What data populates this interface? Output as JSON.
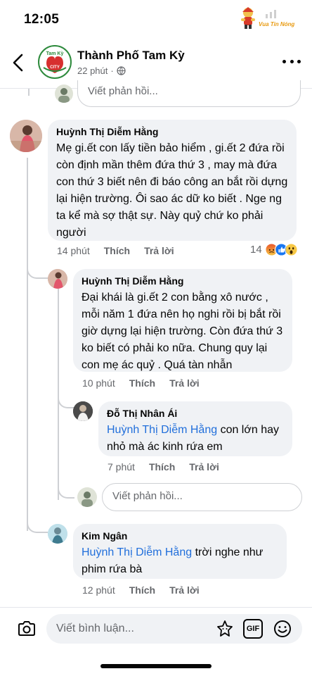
{
  "status_bar": {
    "time": "12:05",
    "watermark_text": "Vua Tin Nóng"
  },
  "header": {
    "page_name": "Thành Phố Tam Kỳ",
    "page_logo_text": "Tam Kỳ",
    "page_logo_sub": "CITY",
    "post_time": "22 phút",
    "audience_icon": "globe-icon"
  },
  "top_reply_placeholder": "Viết phản hồi...",
  "comments": [
    {
      "author": "Huỳnh Thị Diễm Hằng",
      "text": "Mẹ gi.ết con lấy tiền bảo hiểm , gi.ết 2 đứa rồi còn định mần thêm đứa thứ 3 , may mà đứa con thứ 3 biết nên đi báo công an bắt rồi dựng lại hiện trường. Ôi sao ác dữ ko biết . Nge ng ta kể mà sợ thật sự. Này quỷ chứ ko phải người",
      "time": "14 phút",
      "like_label": "Thích",
      "reply_label": "Trả lời",
      "reaction_count": "14",
      "reactions": [
        "angry",
        "like",
        "wow"
      ]
    },
    {
      "author": "Huỳnh Thị Diễm Hằng",
      "text": "Đại khái là gi.ết 2 con bằng xô nước , mỗi năm 1 đứa nên họ nghi rồi bị bắt rồi giờ dựng lại hiện trường. Còn đứa thứ 3 ko biết có phải ko nữa. Chung quy lại con mẹ ác quỷ . Quá tàn nhẫn",
      "time": "10 phút",
      "like_label": "Thích",
      "reply_label": "Trả lời"
    },
    {
      "author": "Đỗ Thị Nhân Ái",
      "mention": "Huỳnh Thị Diễm Hằng",
      "text": "con lớn hay nhỏ mà ác kinh rứa em",
      "time": "7 phút",
      "like_label": "Thích",
      "reply_label": "Trả lời"
    },
    {
      "author": "Kim Ngân",
      "mention": "Huỳnh Thị Diễm Hằng",
      "text": "trời nghe như phim rứa bà",
      "time": "12 phút",
      "like_label": "Thích",
      "reply_label": "Trả lời"
    }
  ],
  "nested_reply_placeholder": "Viết phản hồi...",
  "composer": {
    "placeholder": "Viết bình luận...",
    "gif_label": "GIF"
  }
}
